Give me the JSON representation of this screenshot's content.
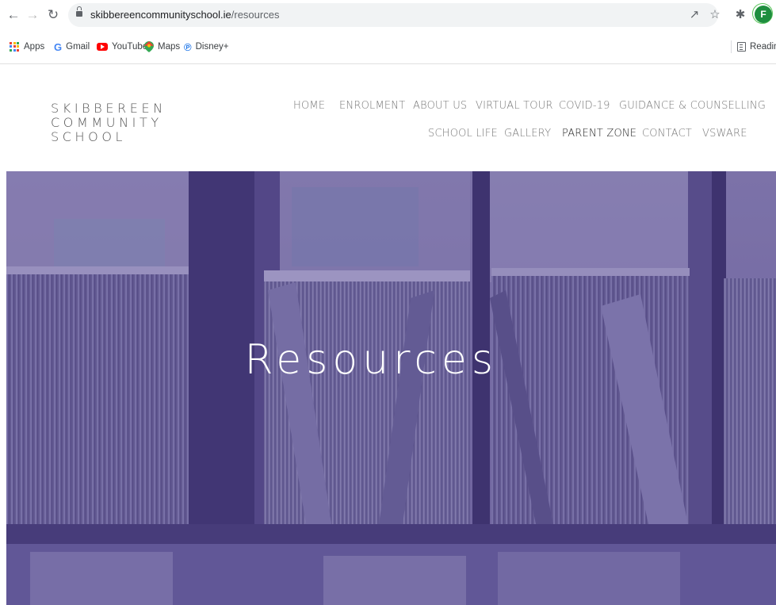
{
  "browser": {
    "url_host": "skibbereencommunityschool.ie",
    "url_path": "/resources",
    "avatar_letter": "F",
    "bookmarks": [
      {
        "label": "Apps",
        "icon": "apps-grid-icon"
      },
      {
        "label": "Gmail",
        "icon": "google-icon"
      },
      {
        "label": "YouTube",
        "icon": "youtube-icon"
      },
      {
        "label": "Maps",
        "icon": "maps-icon"
      },
      {
        "label": "Disney+",
        "icon": "disney-plus-icon"
      }
    ],
    "reading_list": "Reading"
  },
  "site": {
    "logo_line1": "SKIBBEREEN COMMUNITY",
    "logo_line2": "SCHOOL",
    "nav": [
      {
        "label": "HOME"
      },
      {
        "label": "ENROLMENT"
      },
      {
        "label": "ABOUT US"
      },
      {
        "label": "VIRTUAL TOUR"
      },
      {
        "label": "COVID-19"
      },
      {
        "label": "GUIDANCE & COUNSELLING"
      },
      {
        "label": "SCHOOL LIFE"
      },
      {
        "label": "GALLERY"
      },
      {
        "label": "PARENT ZONE"
      },
      {
        "label": "CONTACT"
      },
      {
        "label": "VSWARE"
      }
    ],
    "active_nav": "PARENT ZONE"
  },
  "hero": {
    "title": "Resources",
    "overlay_color": "#4a3d82"
  }
}
